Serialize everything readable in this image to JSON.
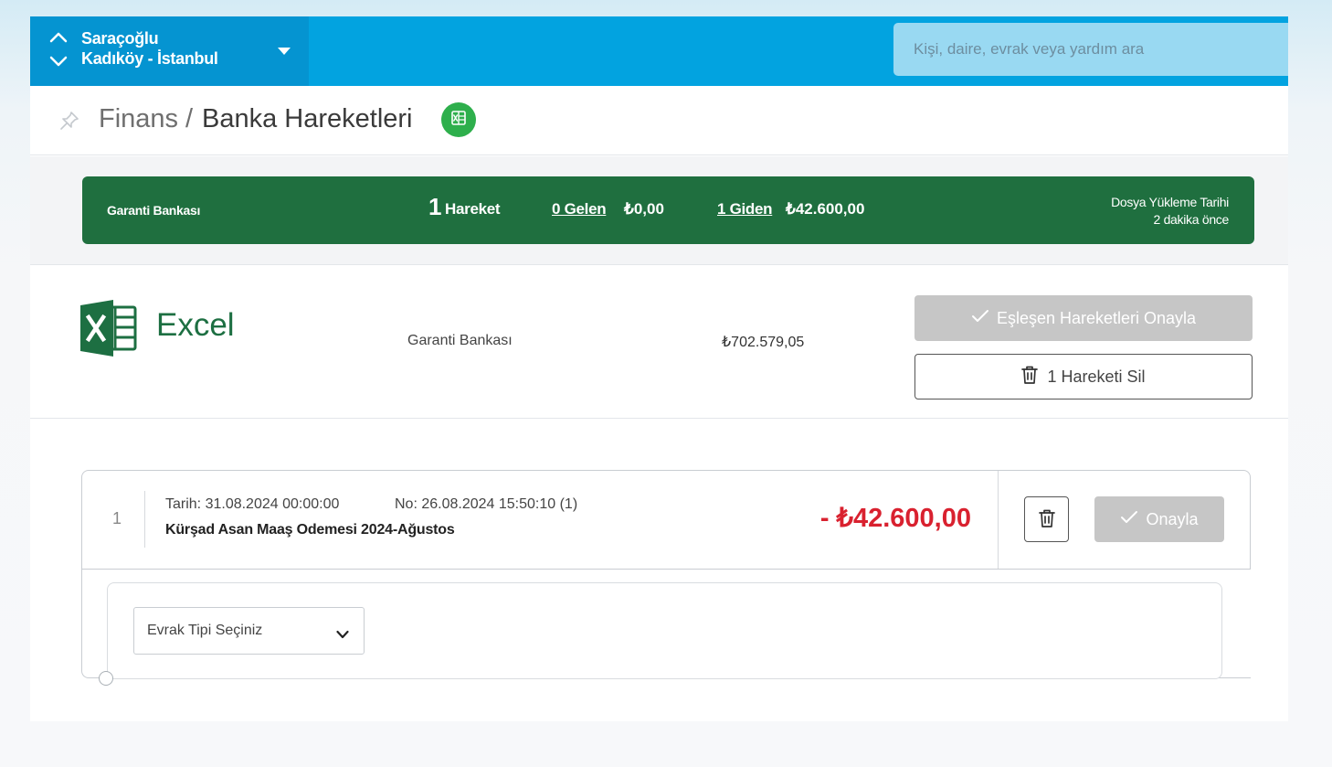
{
  "topbar": {
    "site_name": "Saraçoğlu",
    "site_location": "Kadıköy - İstanbul",
    "search_placeholder": "Kişi, daire, evrak veya yardım ara"
  },
  "breadcrumb": {
    "root": "Finans",
    "separator": "/",
    "current": "Banka Hareketleri"
  },
  "summary": {
    "bank_name": "Garanti Bankası",
    "movement_count": "1",
    "movement_label": "Hareket",
    "incoming_link": "0 Gelen",
    "incoming_amount": "₺0,00",
    "outgoing_link": "1 Giden",
    "outgoing_amount": "₺42.600,00",
    "upload_date_label": "Dosya Yükleme Tarihi",
    "upload_date_value": "2 dakika önce"
  },
  "file": {
    "app_name": "Excel",
    "bank_name": "Garanti Bankası",
    "balance": "₺702.579,05",
    "approve_matched_label": "Eşleşen Hareketleri Onayla",
    "delete_label": "1 Hareketi Sil"
  },
  "transactions": [
    {
      "index": "1",
      "date": "Tarih: 31.08.2024 00:00:00",
      "number": "No: 26.08.2024 15:50:10 (1)",
      "description": "Kürşad Asan Maaş Odemesi 2024-Ağustos",
      "amount": "- ₺42.600,00",
      "approve_label": "Onayla",
      "document_type_placeholder": "Evrak Tipi Seçiniz"
    }
  ],
  "colors": {
    "topbar": "#02a3e0",
    "site_switch": "#0594d1",
    "summary_band": "#1f6f3f",
    "excel_green": "#1d6f42",
    "negative_amount": "#d9212f",
    "disabled_button": "#c6c6c6"
  },
  "icons": {
    "site_switch": "chevron-up-down-icon",
    "site_dropdown": "caret-down-icon",
    "pin": "pin-icon",
    "export": "excel-icon",
    "logo": "excel-logo-icon",
    "approve": "check-icon",
    "delete": "trash-icon",
    "select": "chevron-down-icon"
  }
}
